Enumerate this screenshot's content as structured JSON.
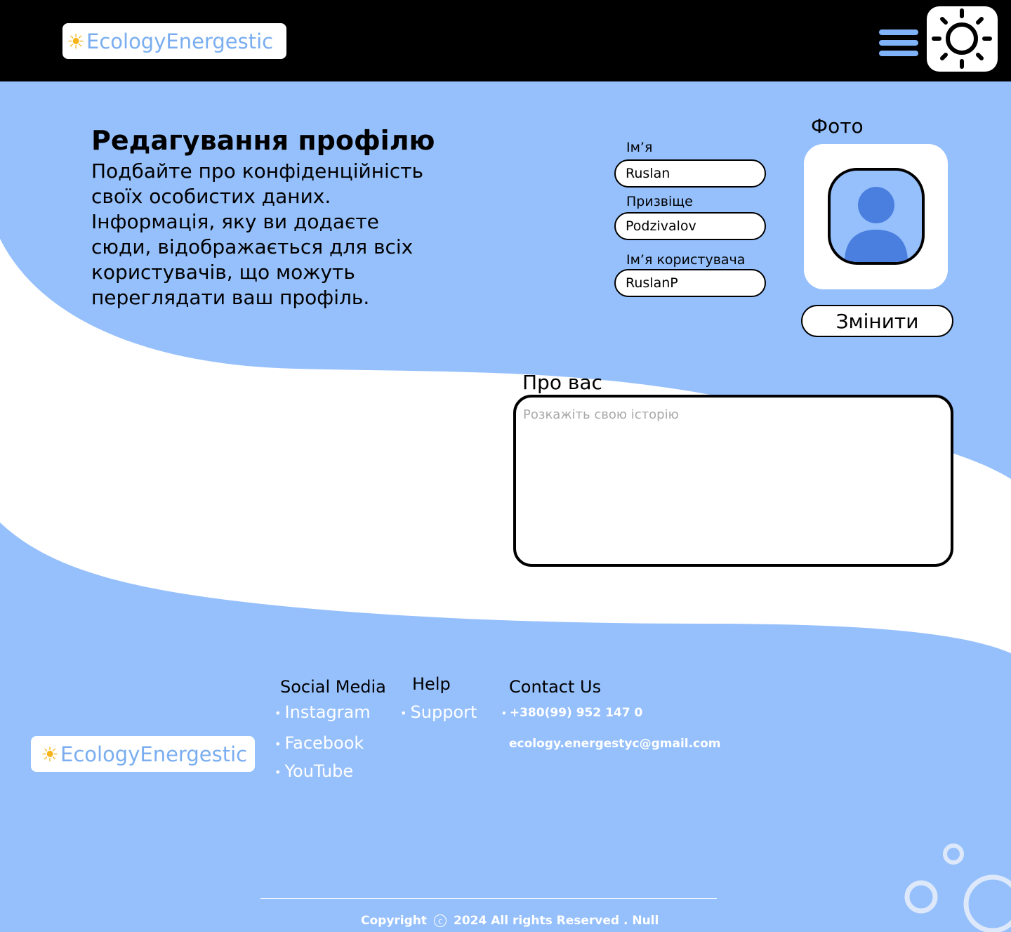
{
  "header": {
    "logo_sun": "☀",
    "logo_text": "EcologyEnergestic",
    "menu_icon": "hamburger-menu-icon",
    "theme_icon": "sun-icon"
  },
  "intro": {
    "title": "Редагування профілю",
    "description": "Подбайте про конфіденційність своїх особистих даних. Інформація, яку ви додаєте сюди, відображається для всіх користувачів, що можуть переглядати ваш профіль."
  },
  "form": {
    "first_name_label": "Ім’я",
    "first_name_value": "Ruslan",
    "last_name_label": "Призвіще",
    "last_name_value": "Podzivalov",
    "username_label": "Ім’я користувача",
    "username_value": "RuslanP",
    "photo_label": "Фото",
    "change_button": "Змінити",
    "about_label": "Про вас",
    "about_placeholder": "Розкажіть свою історію"
  },
  "footer": {
    "logo_sun": "☀",
    "logo_text": "EcologyEnergestic",
    "social_heading": "Social Media",
    "social_links": [
      "Instagram",
      "Facebook",
      "YouTube"
    ],
    "help_heading": "Help",
    "help_links": [
      "Support"
    ],
    "contact_heading": "Contact Us",
    "phone": "+380(99) 952 147 0",
    "email": "ecology.energestyc@gmail.com",
    "copyright_prefix": "Copyright",
    "copyright_symbol": "c",
    "copyright_text": "2024 All rights Reserved . Null"
  },
  "colors": {
    "header_bg": "#000000",
    "accent_blue": "#96c0fc",
    "avatar_blue": "#4a7fe0",
    "logo_text": "#7aaef0",
    "sun": "#f6b41a"
  }
}
